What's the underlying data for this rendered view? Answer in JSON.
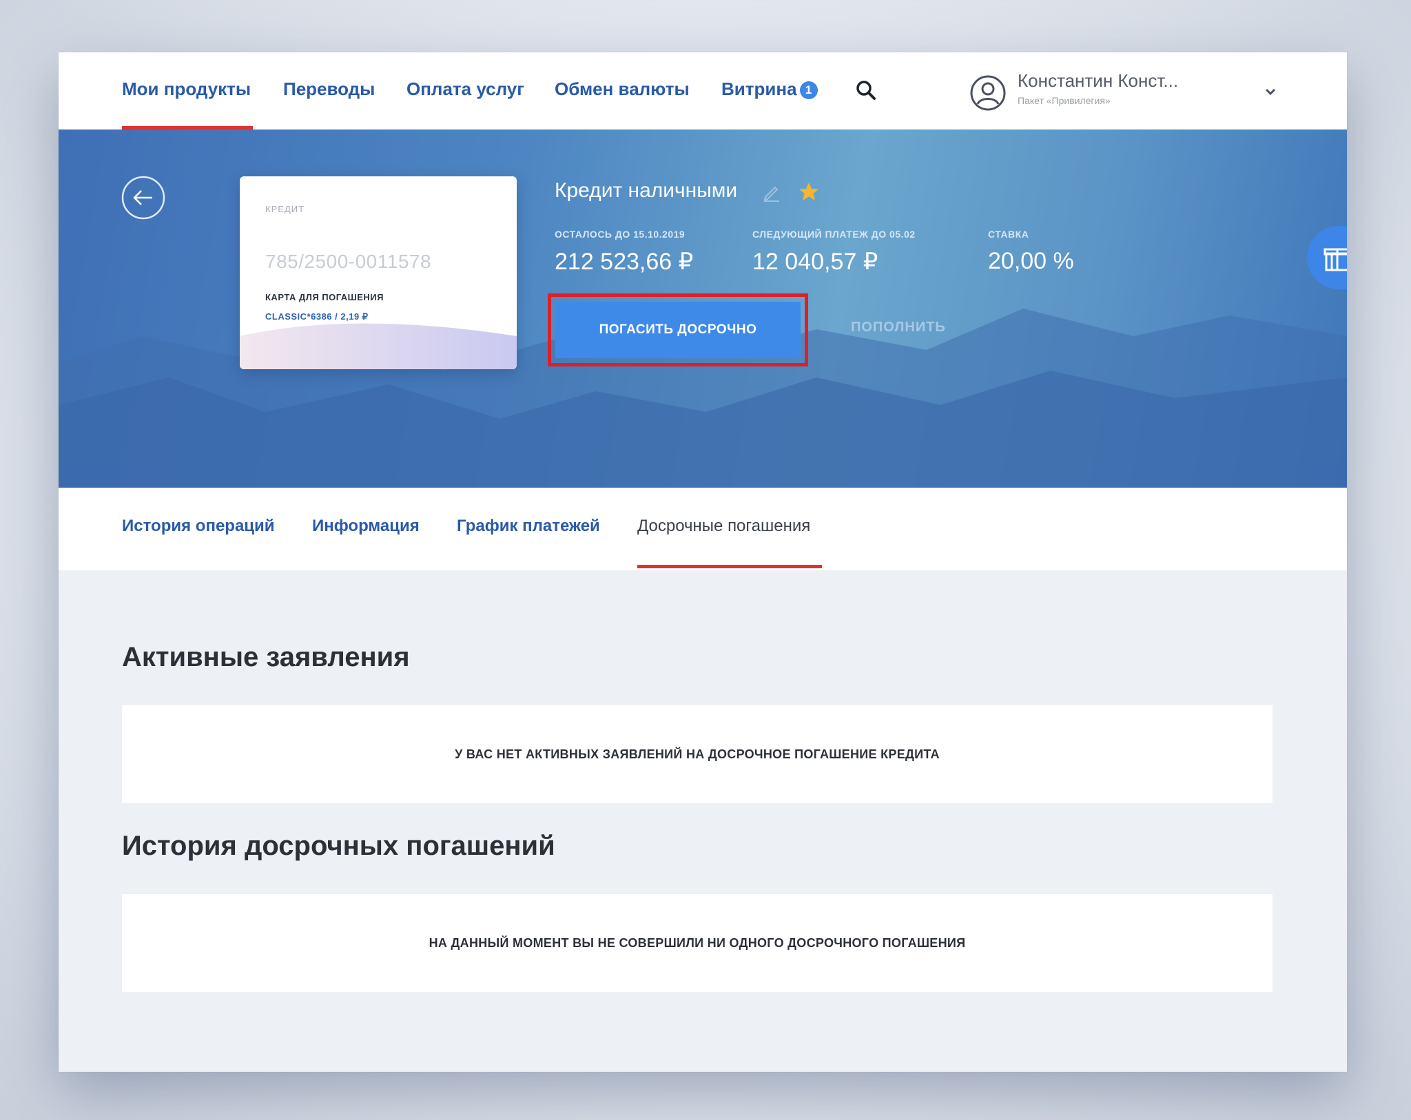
{
  "nav": {
    "items": [
      {
        "label": "Мои продукты"
      },
      {
        "label": "Переводы"
      },
      {
        "label": "Оплата услуг"
      },
      {
        "label": "Обмен валюты"
      },
      {
        "label": "Витрина"
      }
    ],
    "showcase_badge": "1",
    "search_icon": "search-icon",
    "accent_color": "#e0312f",
    "link_color": "#2a5aa8"
  },
  "user": {
    "name": "Константин Конст...",
    "package": "Пакет «Привилегия»",
    "avatar_icon": "user-circle-icon",
    "chevron_icon": "chevron-down-icon"
  },
  "product": {
    "title": "Кредит наличными",
    "card": {
      "type": "КРЕДИТ",
      "number": "785/2500-0011578",
      "repay_label": "КАРТА ДЛЯ ПОГАШЕНИЯ",
      "repay_value": "CLASSIC*6386 / 2,19 ₽"
    },
    "stats": [
      {
        "label": "ОСТАЛОСЬ ДО 15.10.2019",
        "value": "212 523,66 ₽"
      },
      {
        "label": "СЛЕДУЮЩИЙ ПЛАТЕЖ ДО 05.02",
        "value": "12 040,57 ₽"
      },
      {
        "label": "СТАВКА",
        "value": "20,00 %"
      }
    ],
    "repay_button": "ПОГАСИТЬ ДОСРОЧНО",
    "topup_button": "ПОПОЛНИТЬ",
    "button_color": "#3e8ae8",
    "highlight_color": "#e01e26"
  },
  "tabs": [
    {
      "label": "История операций"
    },
    {
      "label": "Информация"
    },
    {
      "label": "График платежей"
    },
    {
      "label": "Досрочные погашения"
    }
  ],
  "active_tab": "Досрочные погашения",
  "sections": {
    "active_requests": {
      "title": "Активные заявления",
      "empty_text": "У ВАС НЕТ АКТИВНЫХ ЗАЯВЛЕНИЙ НА ДОСРОЧНОЕ ПОГАШЕНИЕ КРЕДИТА"
    },
    "history": {
      "title": "История досрочных погашений",
      "empty_text": "НА ДАННЫЙ МОМЕНТ ВЫ НЕ СОВЕРШИЛИ НИ ОДНОГО ДОСРОЧНОГО ПОГАШЕНИЯ"
    }
  }
}
